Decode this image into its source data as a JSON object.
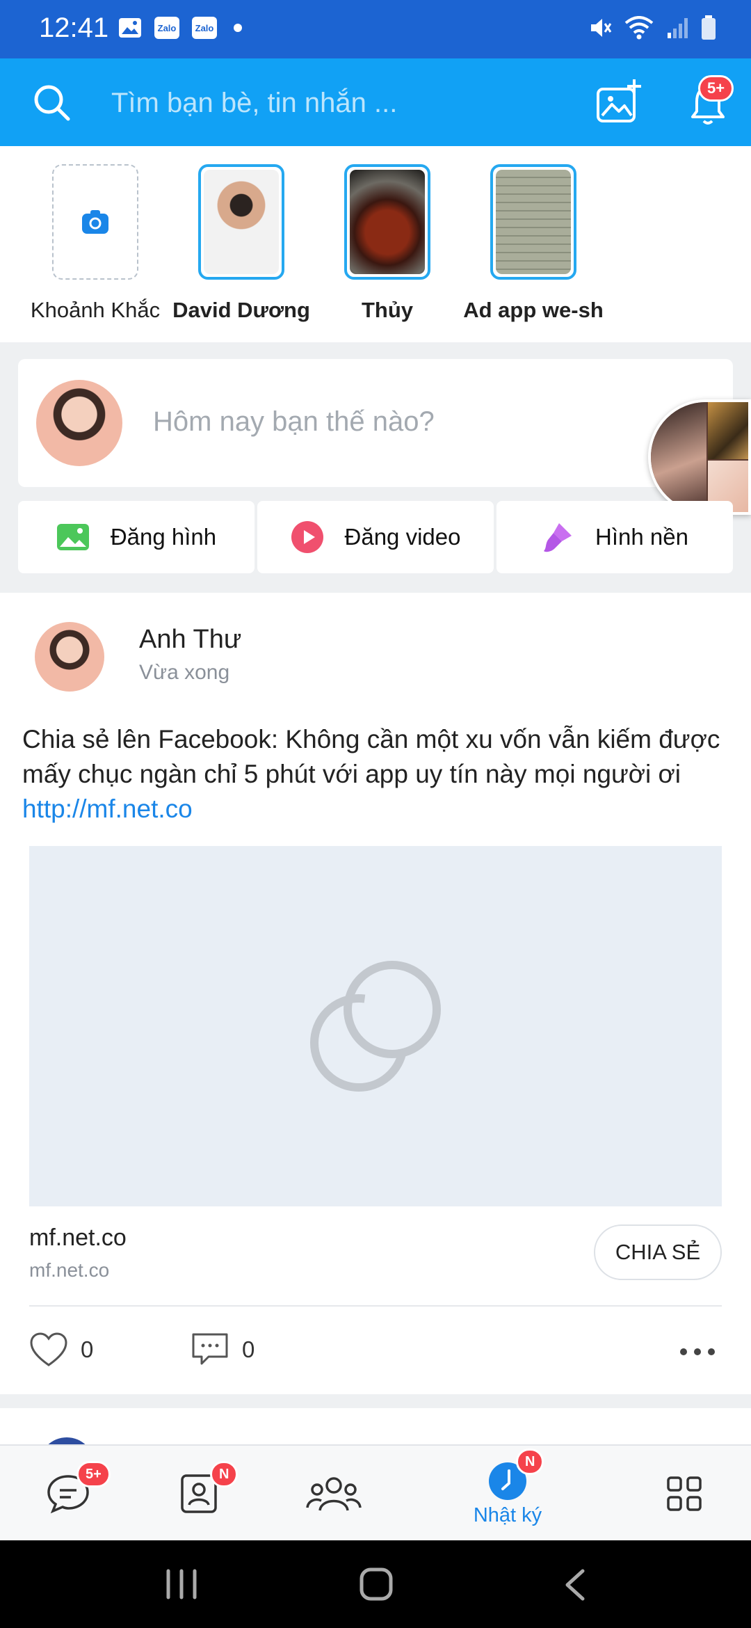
{
  "status_bar": {
    "time": "12:41",
    "notif_labels": [
      "Zalo",
      "Zalo"
    ]
  },
  "header": {
    "search_placeholder": "Tìm bạn bè, tin nhắn ...",
    "notification_badge": "5+"
  },
  "stories": [
    {
      "label": "Khoảnh Khắc",
      "type": "add"
    },
    {
      "label": "David Dương",
      "type": "person"
    },
    {
      "label": "Thủy",
      "type": "food"
    },
    {
      "label": "Ad app we-sh",
      "type": "document"
    }
  ],
  "composer": {
    "placeholder": "Hôm nay bạn thế nào?",
    "actions": [
      {
        "label": "Đăng hình",
        "icon": "image-icon",
        "color": "#4cc75a"
      },
      {
        "label": "Đăng video",
        "icon": "video-play-icon",
        "color": "#f0506e"
      },
      {
        "label": "Hình nền",
        "icon": "paint-brush-icon",
        "color": "#c96ff0"
      }
    ]
  },
  "post": {
    "author": "Anh Thư",
    "time": "Vừa xong",
    "text": "Chia sẻ lên Facebook: Không cần một xu vốn vẫn kiếm được mấy chục ngàn chỉ 5 phút với app uy tín này mọi người ơi ",
    "link": "http://mf.net.co",
    "preview_title": "mf.net.co",
    "preview_domain": "mf.net.co",
    "share_label": "CHIA SẺ",
    "likes": "0",
    "comments": "0"
  },
  "bottom_nav": {
    "messages_badge": "5+",
    "contacts_badge": "N",
    "timeline_badge": "N",
    "timeline_label": "Nhật ký",
    "active_color": "#1a86e8"
  }
}
